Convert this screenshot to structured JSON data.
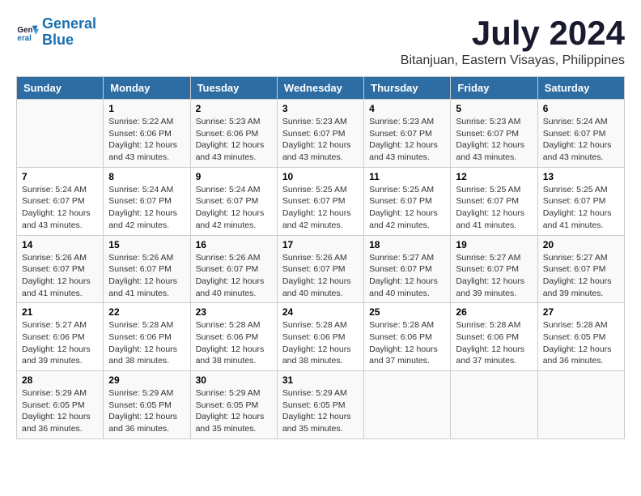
{
  "logo": {
    "text_general": "General",
    "text_blue": "Blue"
  },
  "title": "July 2024",
  "location": "Bitanjuan, Eastern Visayas, Philippines",
  "days_header": [
    "Sunday",
    "Monday",
    "Tuesday",
    "Wednesday",
    "Thursday",
    "Friday",
    "Saturday"
  ],
  "weeks": [
    [
      {
        "day": "",
        "info": ""
      },
      {
        "day": "1",
        "info": "Sunrise: 5:22 AM\nSunset: 6:06 PM\nDaylight: 12 hours\nand 43 minutes."
      },
      {
        "day": "2",
        "info": "Sunrise: 5:23 AM\nSunset: 6:06 PM\nDaylight: 12 hours\nand 43 minutes."
      },
      {
        "day": "3",
        "info": "Sunrise: 5:23 AM\nSunset: 6:07 PM\nDaylight: 12 hours\nand 43 minutes."
      },
      {
        "day": "4",
        "info": "Sunrise: 5:23 AM\nSunset: 6:07 PM\nDaylight: 12 hours\nand 43 minutes."
      },
      {
        "day": "5",
        "info": "Sunrise: 5:23 AM\nSunset: 6:07 PM\nDaylight: 12 hours\nand 43 minutes."
      },
      {
        "day": "6",
        "info": "Sunrise: 5:24 AM\nSunset: 6:07 PM\nDaylight: 12 hours\nand 43 minutes."
      }
    ],
    [
      {
        "day": "7",
        "info": "Sunrise: 5:24 AM\nSunset: 6:07 PM\nDaylight: 12 hours\nand 43 minutes."
      },
      {
        "day": "8",
        "info": "Sunrise: 5:24 AM\nSunset: 6:07 PM\nDaylight: 12 hours\nand 42 minutes."
      },
      {
        "day": "9",
        "info": "Sunrise: 5:24 AM\nSunset: 6:07 PM\nDaylight: 12 hours\nand 42 minutes."
      },
      {
        "day": "10",
        "info": "Sunrise: 5:25 AM\nSunset: 6:07 PM\nDaylight: 12 hours\nand 42 minutes."
      },
      {
        "day": "11",
        "info": "Sunrise: 5:25 AM\nSunset: 6:07 PM\nDaylight: 12 hours\nand 42 minutes."
      },
      {
        "day": "12",
        "info": "Sunrise: 5:25 AM\nSunset: 6:07 PM\nDaylight: 12 hours\nand 41 minutes."
      },
      {
        "day": "13",
        "info": "Sunrise: 5:25 AM\nSunset: 6:07 PM\nDaylight: 12 hours\nand 41 minutes."
      }
    ],
    [
      {
        "day": "14",
        "info": "Sunrise: 5:26 AM\nSunset: 6:07 PM\nDaylight: 12 hours\nand 41 minutes."
      },
      {
        "day": "15",
        "info": "Sunrise: 5:26 AM\nSunset: 6:07 PM\nDaylight: 12 hours\nand 41 minutes."
      },
      {
        "day": "16",
        "info": "Sunrise: 5:26 AM\nSunset: 6:07 PM\nDaylight: 12 hours\nand 40 minutes."
      },
      {
        "day": "17",
        "info": "Sunrise: 5:26 AM\nSunset: 6:07 PM\nDaylight: 12 hours\nand 40 minutes."
      },
      {
        "day": "18",
        "info": "Sunrise: 5:27 AM\nSunset: 6:07 PM\nDaylight: 12 hours\nand 40 minutes."
      },
      {
        "day": "19",
        "info": "Sunrise: 5:27 AM\nSunset: 6:07 PM\nDaylight: 12 hours\nand 39 minutes."
      },
      {
        "day": "20",
        "info": "Sunrise: 5:27 AM\nSunset: 6:07 PM\nDaylight: 12 hours\nand 39 minutes."
      }
    ],
    [
      {
        "day": "21",
        "info": "Sunrise: 5:27 AM\nSunset: 6:06 PM\nDaylight: 12 hours\nand 39 minutes."
      },
      {
        "day": "22",
        "info": "Sunrise: 5:28 AM\nSunset: 6:06 PM\nDaylight: 12 hours\nand 38 minutes."
      },
      {
        "day": "23",
        "info": "Sunrise: 5:28 AM\nSunset: 6:06 PM\nDaylight: 12 hours\nand 38 minutes."
      },
      {
        "day": "24",
        "info": "Sunrise: 5:28 AM\nSunset: 6:06 PM\nDaylight: 12 hours\nand 38 minutes."
      },
      {
        "day": "25",
        "info": "Sunrise: 5:28 AM\nSunset: 6:06 PM\nDaylight: 12 hours\nand 37 minutes."
      },
      {
        "day": "26",
        "info": "Sunrise: 5:28 AM\nSunset: 6:06 PM\nDaylight: 12 hours\nand 37 minutes."
      },
      {
        "day": "27",
        "info": "Sunrise: 5:28 AM\nSunset: 6:05 PM\nDaylight: 12 hours\nand 36 minutes."
      }
    ],
    [
      {
        "day": "28",
        "info": "Sunrise: 5:29 AM\nSunset: 6:05 PM\nDaylight: 12 hours\nand 36 minutes."
      },
      {
        "day": "29",
        "info": "Sunrise: 5:29 AM\nSunset: 6:05 PM\nDaylight: 12 hours\nand 36 minutes."
      },
      {
        "day": "30",
        "info": "Sunrise: 5:29 AM\nSunset: 6:05 PM\nDaylight: 12 hours\nand 35 minutes."
      },
      {
        "day": "31",
        "info": "Sunrise: 5:29 AM\nSunset: 6:05 PM\nDaylight: 12 hours\nand 35 minutes."
      },
      {
        "day": "",
        "info": ""
      },
      {
        "day": "",
        "info": ""
      },
      {
        "day": "",
        "info": ""
      }
    ]
  ]
}
